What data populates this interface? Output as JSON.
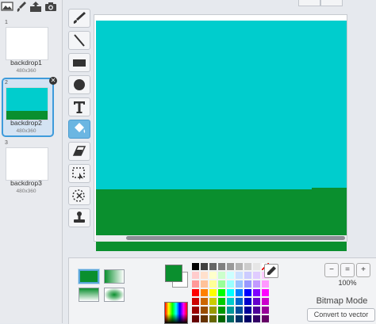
{
  "backdrops": [
    {
      "index": "1",
      "name": "backdrop1",
      "size": "480x360"
    },
    {
      "index": "2",
      "name": "backdrop2",
      "size": "480x360",
      "selected": true
    },
    {
      "index": "3",
      "name": "backdrop3",
      "size": "480x360"
    }
  ],
  "delete_label": "✕",
  "new_backdrop_icons": [
    "landscape-library-icon",
    "paint-brush-icon",
    "upload-icon",
    "camera-icon"
  ],
  "tools": [
    "brush-icon",
    "line-icon",
    "rectangle-icon",
    "ellipse-icon",
    "text-icon",
    "fill-bucket-icon",
    "eraser-icon",
    "select-icon",
    "select-to-clone-icon",
    "stamp-icon"
  ],
  "active_tool": "fill-bucket-icon",
  "canvas": {
    "sky_color": "#00cdcd",
    "ground_color": "#0a8f2e"
  },
  "colors": {
    "primary": "#0a8f2e",
    "secondary": "#ffffff",
    "accent": "#3e9bdb"
  },
  "zoom": {
    "out_label": "−",
    "reset_label": "=",
    "in_label": "+",
    "level": "100%"
  },
  "mode_label": "Bitmap Mode",
  "convert_label": "Convert to vector"
}
